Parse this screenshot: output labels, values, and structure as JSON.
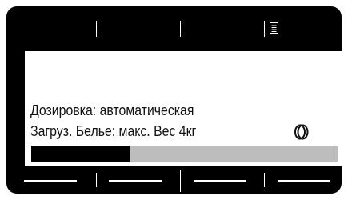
{
  "display": {
    "line1": "Дозировка: автоматическая",
    "line2": "Загруз. Белье: макс. Вес 4кг"
  },
  "progress": {
    "fraction": 0.32
  },
  "icons": {
    "menu": "menu-list-icon",
    "load": "drum-load-icon"
  },
  "colors": {
    "frame": "#000000",
    "screen": "#ffffff",
    "progress_track": "#bdbdbd",
    "progress_fill": "#000000"
  }
}
